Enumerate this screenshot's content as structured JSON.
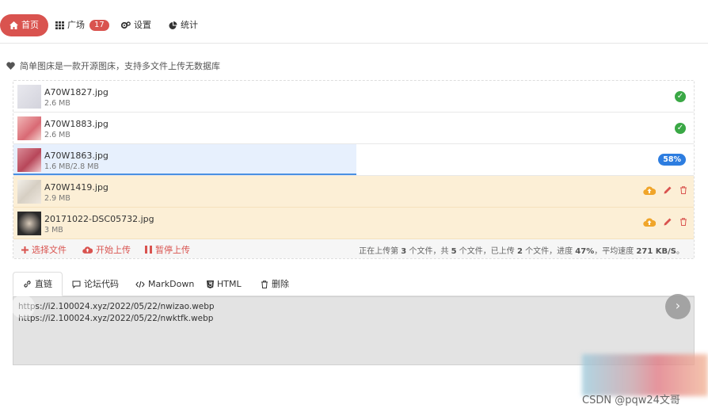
{
  "nav": {
    "home": "首页",
    "plaza": "广场",
    "plaza_count": "17",
    "settings": "设置",
    "stats": "统计"
  },
  "intro": "简单图床是一款开源图床，支持多文件上传无数据库",
  "files": [
    {
      "name": "A70W1827.jpg",
      "size": "2.6 MB",
      "status": "done"
    },
    {
      "name": "A70W1883.jpg",
      "size": "2.6 MB",
      "status": "done"
    },
    {
      "name": "A70W1863.jpg",
      "size": "1.6 MB/2.8 MB",
      "status": "uploading",
      "progress": "58%"
    },
    {
      "name": "A70W1419.jpg",
      "size": "2.9 MB",
      "status": "pending"
    },
    {
      "name": "20171022-DSC05732.jpg",
      "size": "3 MB",
      "status": "pending"
    }
  ],
  "toolbar": {
    "select": "选择文件",
    "start": "开始上传",
    "pause": "暂停上传",
    "status_parts": [
      "正在上传第 ",
      "3",
      " 个文件，共 ",
      "5",
      " 个文件，已上传 ",
      "2",
      " 个文件，进度 ",
      "47%",
      "，平均速度 ",
      "271 KB/S",
      "。"
    ]
  },
  "tabs": [
    "直链",
    "论坛代码",
    "MarkDown",
    "HTML",
    "删除"
  ],
  "links": [
    "https://i2.100024.xyz/2022/05/22/nwizao.webp",
    "https://i2.100024.xyz/2022/05/22/nwktfk.webp"
  ],
  "watermark": "CSDN @pqw24文哥",
  "colors": {
    "accent": "#d9534f",
    "ok": "#3aa845",
    "progress": "#2d7de0",
    "warn_bg": "#fcefd6"
  }
}
